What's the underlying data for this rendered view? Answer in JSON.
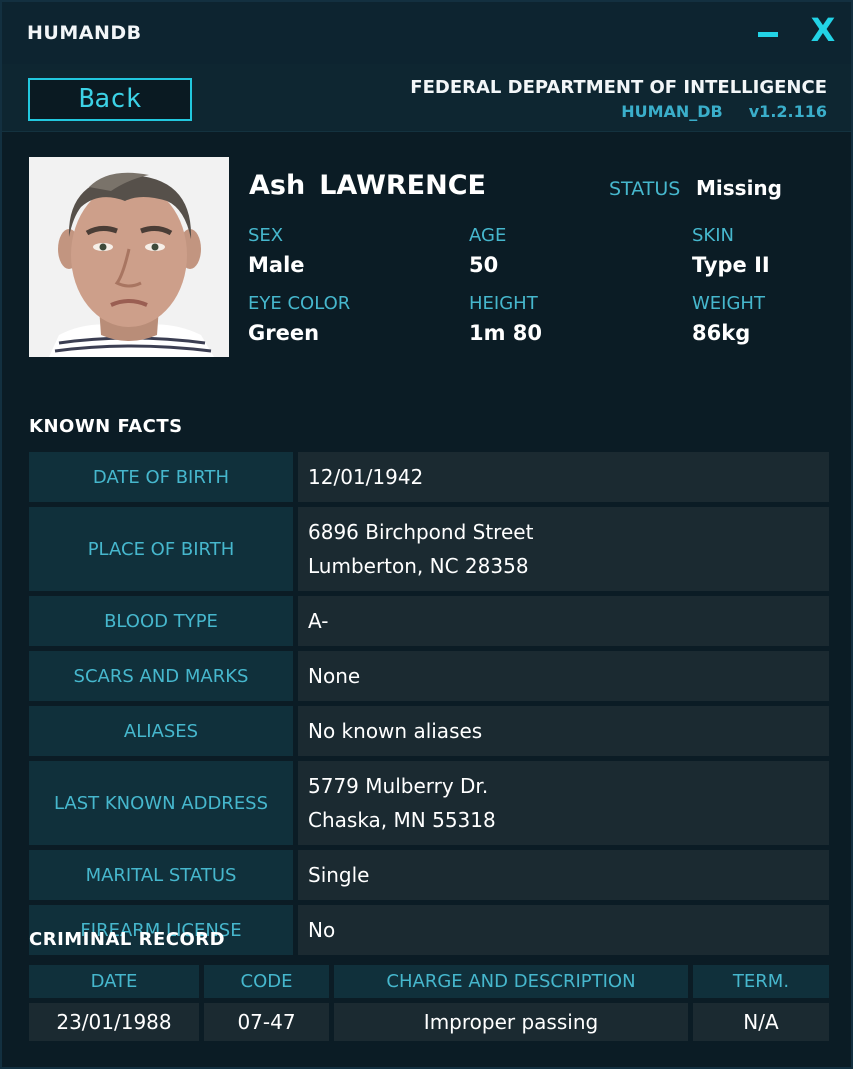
{
  "window": {
    "app_name": "HUMANDB",
    "minimize_icon": "minimize-icon",
    "close_label": "X"
  },
  "header": {
    "back_label": "Back",
    "organization": "FEDERAL DEPARTMENT OF INTELLIGENCE",
    "db_name": "HUMAN_DB",
    "version": "v1.2.116"
  },
  "profile": {
    "first_name": "Ash",
    "last_name": "LAWRENCE",
    "status_label": "STATUS",
    "status_value": "Missing",
    "sex_label": "SEX",
    "sex_value": "Male",
    "age_label": "AGE",
    "age_value": "50",
    "skin_label": "SKIN",
    "skin_value": "Type II",
    "eye_label": "EYE COLOR",
    "eye_value": "Green",
    "height_label": "HEIGHT",
    "height_value": "1m 80",
    "weight_label": "WEIGHT",
    "weight_value": "86kg"
  },
  "known_facts": {
    "title": "KNOWN  FACTS",
    "rows": [
      {
        "label": "DATE OF BIRTH",
        "line1": "12/01/1942",
        "line2": ""
      },
      {
        "label": "PLACE OF BIRTH",
        "line1": "6896 Birchpond Street",
        "line2": "Lumberton, NC 28358"
      },
      {
        "label": "BLOOD TYPE",
        "line1": "A-",
        "line2": ""
      },
      {
        "label": "SCARS AND MARKS",
        "line1": "None",
        "line2": ""
      },
      {
        "label": "ALIASES",
        "line1": "No known aliases",
        "line2": ""
      },
      {
        "label": "LAST KNOWN ADDRESS",
        "line1": "5779 Mulberry Dr.",
        "line2": "Chaska, MN 55318"
      },
      {
        "label": "MARITAL STATUS",
        "line1": "Single",
        "line2": ""
      },
      {
        "label": "FIREARM LICENSE",
        "line1": "No",
        "line2": ""
      }
    ]
  },
  "criminal_record": {
    "title": "CRIMINAL  RECORD",
    "headers": [
      "DATE",
      "CODE",
      "CHARGE AND DESCRIPTION",
      "TERM."
    ],
    "rows": [
      [
        "23/01/1988",
        "07-47",
        "Improper passing",
        "N/A"
      ]
    ]
  },
  "colors": {
    "accent": "#22d3e6",
    "label": "#46b7cd",
    "background": "#0b1c25"
  }
}
